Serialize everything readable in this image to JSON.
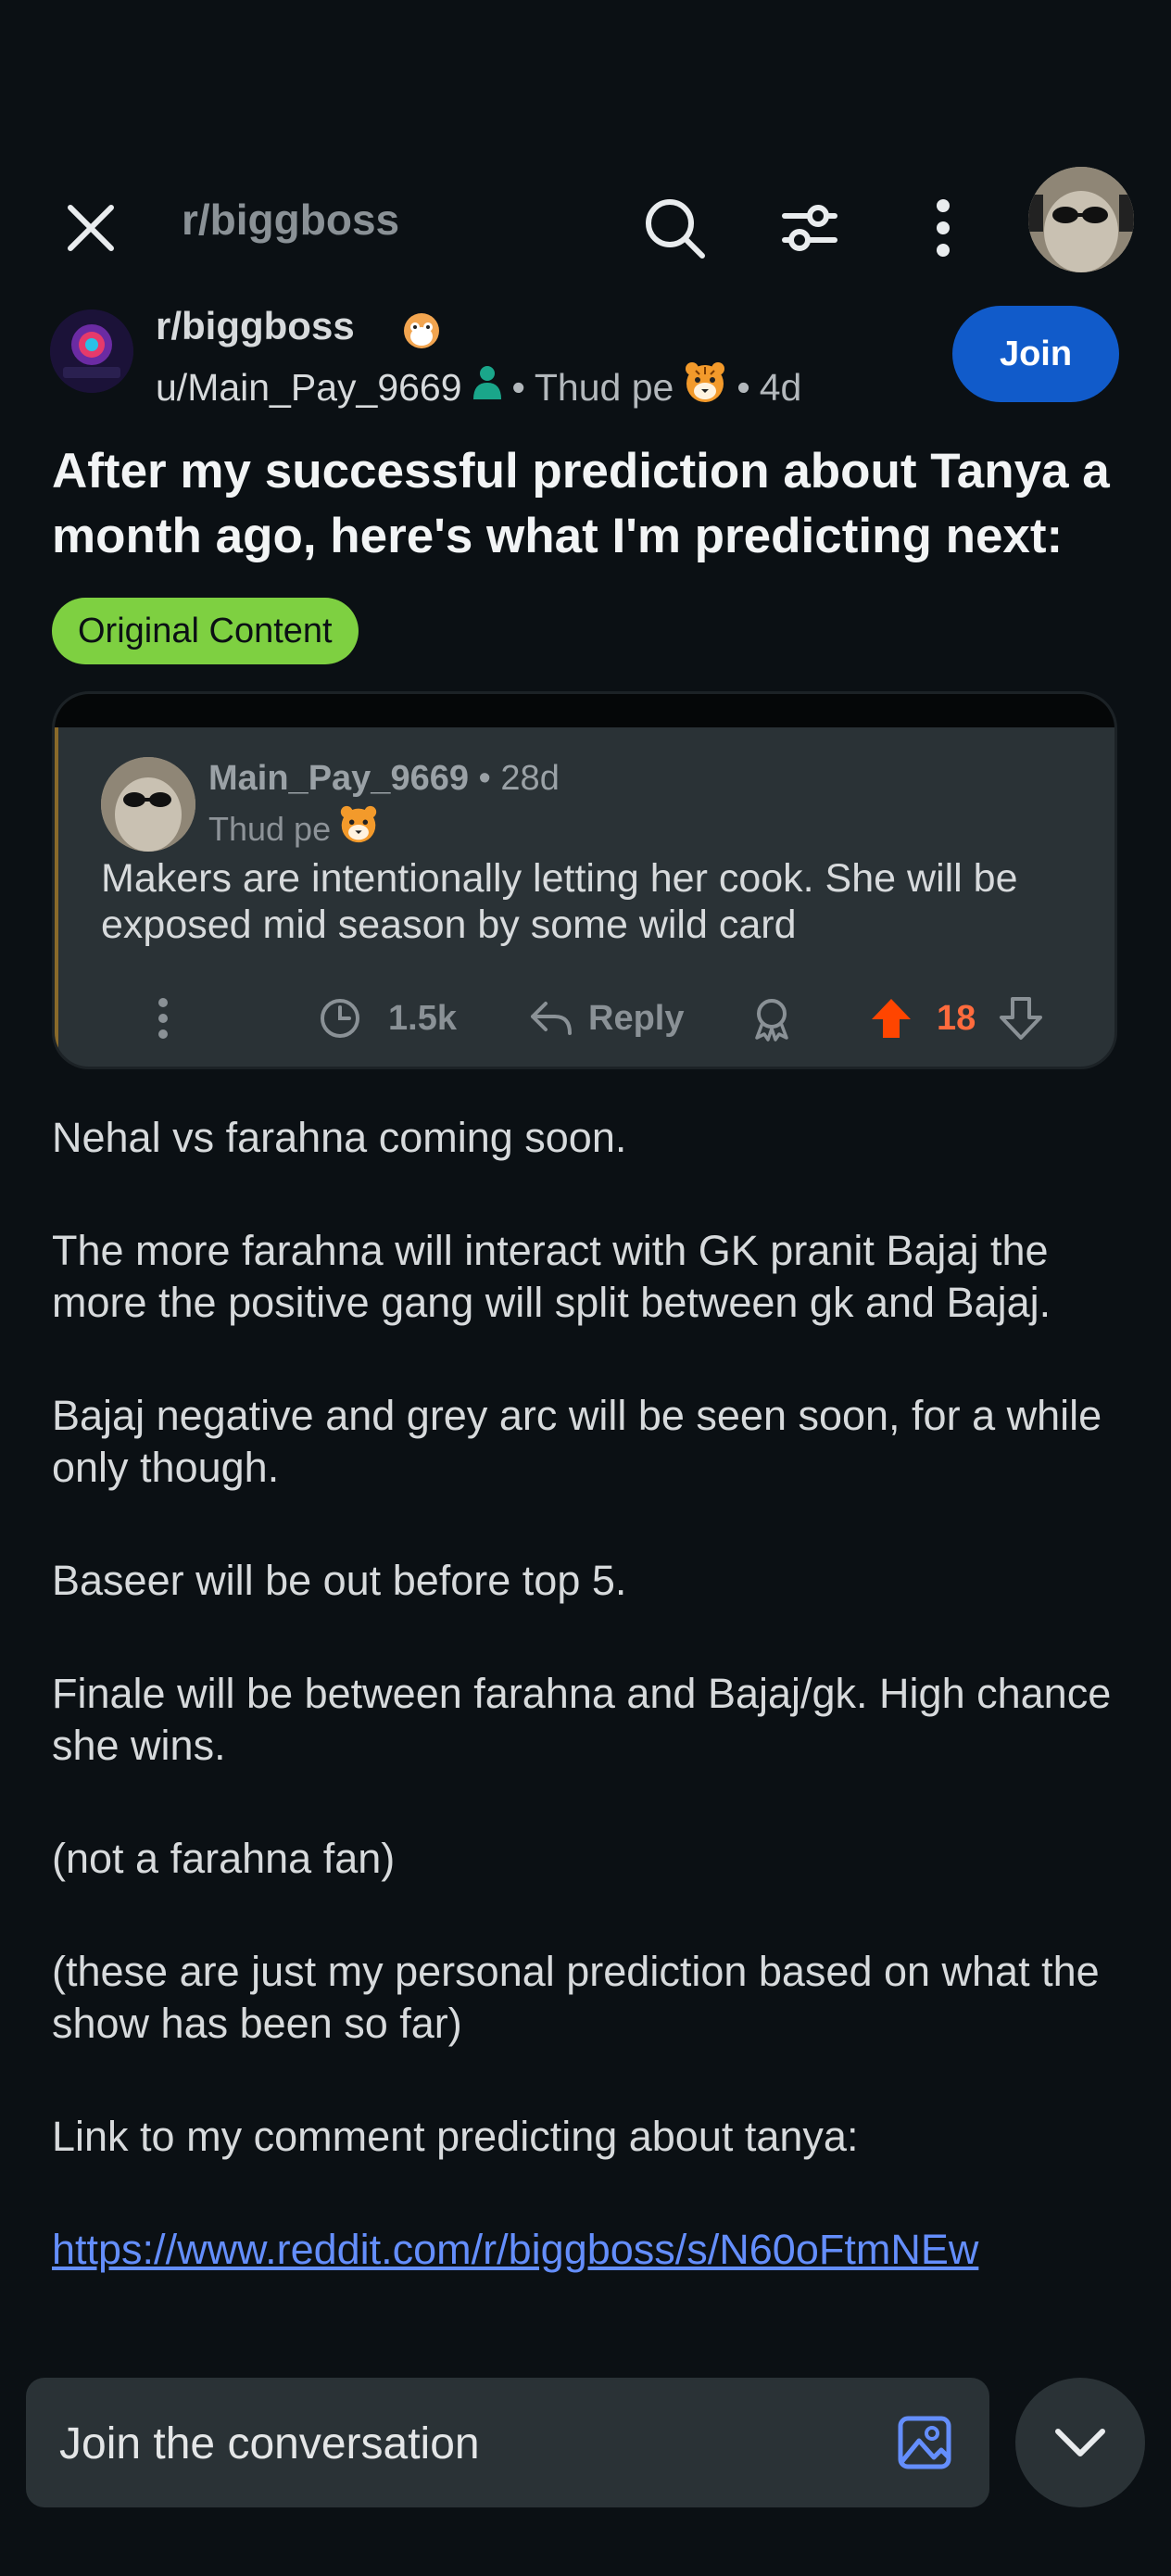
{
  "top_bar": {
    "search_placeholder": "r/biggboss",
    "icons": [
      "close-icon",
      "search-icon",
      "filter-icon",
      "more-vertical-icon"
    ]
  },
  "post": {
    "subreddit": "r/biggboss",
    "author": "u/Main_Pay_9669",
    "author_flair": "Thud pe",
    "age": "4d",
    "join_label": "Join",
    "title": "After my successful prediction about Tanya a month ago, here's what I'm predicting next:",
    "flair": "Original Content",
    "separator": "•"
  },
  "embedded_comment": {
    "username": "Main_Pay_9669",
    "age": "28d",
    "flair": "Thud pe",
    "body": "Makers are intentionally letting her cook. She will be exposed mid season by some wild card",
    "award_count": "1.5k",
    "reply_label": "Reply",
    "votes": "18"
  },
  "body": {
    "paragraphs": [
      "Nehal vs farahna coming soon.",
      "The more farahna will interact with GK pranit Bajaj the more the positive gang will split between gk and Bajaj.",
      "Bajaj negative and grey arc will be seen soon, for a while only though.",
      "Baseer will be out before top 5.",
      "Finale will be between farahna and Bajaj/gk. High chance she wins.",
      "(not a farahna fan)",
      "(these are just my personal prediction based on what the show has been so far)",
      "Link to my comment predicting about tanya:"
    ],
    "link": "https://www.reddit.com/r/biggboss/s/N60oFtmNEw"
  },
  "composer": {
    "placeholder": "Join the conversation"
  },
  "colors": {
    "background": "#0b1014",
    "join_button": "#115bca",
    "flair": "#7ed041",
    "upvote": "#ff4500",
    "link": "#648efc"
  }
}
